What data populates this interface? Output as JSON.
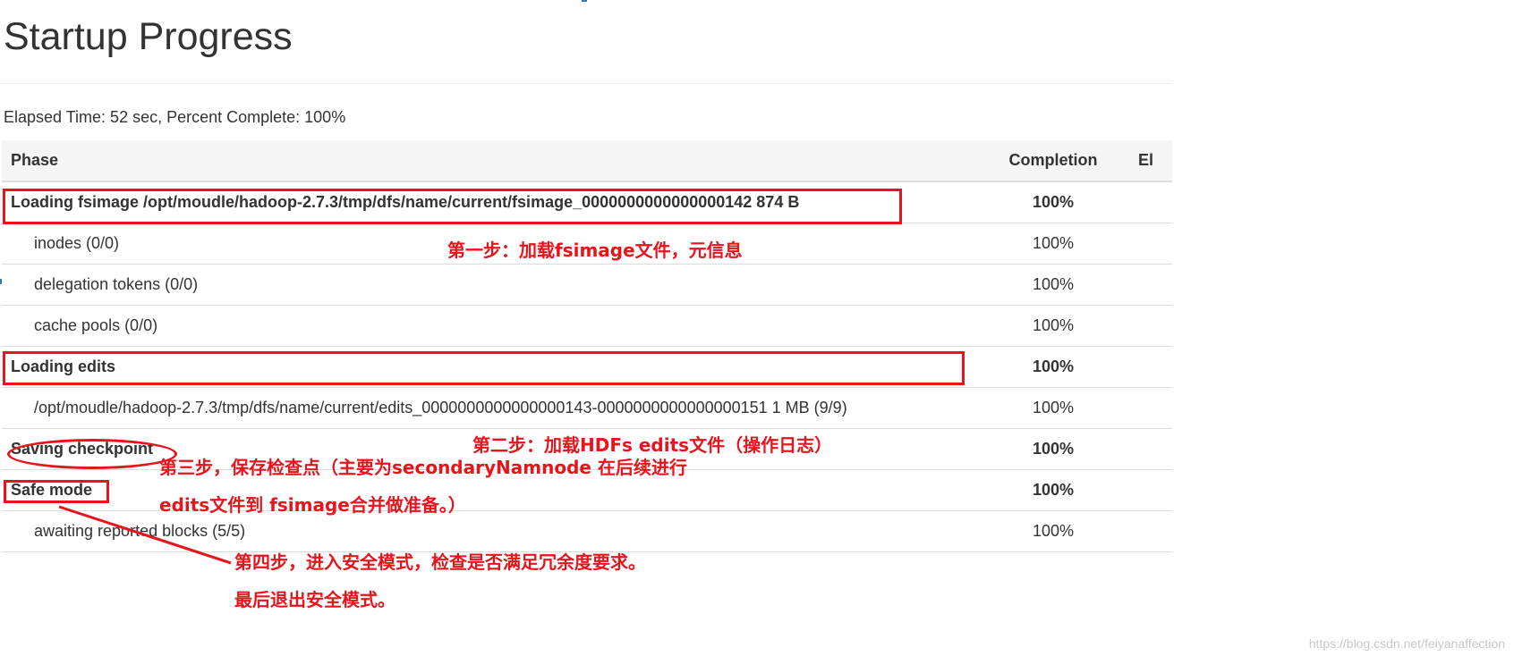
{
  "page": {
    "title": "Startup Progress",
    "elapsed_summary": "Elapsed Time: 52 sec, Percent Complete: 100%"
  },
  "table": {
    "columns": {
      "phase": "Phase",
      "completion": "Completion",
      "elapsed": "El"
    },
    "rows": [
      {
        "kind": "phase",
        "label": "Loading fsimage /opt/moudle/hadoop-2.7.3/tmp/dfs/name/current/fsimage_0000000000000000142 874 B",
        "completion": "100%"
      },
      {
        "kind": "step",
        "label": "inodes (0/0)",
        "completion": "100%"
      },
      {
        "kind": "step",
        "label": "delegation tokens (0/0)",
        "completion": "100%"
      },
      {
        "kind": "step",
        "label": "cache pools (0/0)",
        "completion": "100%"
      },
      {
        "kind": "phase",
        "label": "Loading edits",
        "completion": "100%"
      },
      {
        "kind": "step",
        "label": "/opt/moudle/hadoop-2.7.3/tmp/dfs/name/current/edits_0000000000000000143-0000000000000000151 1 MB (9/9)",
        "completion": "100%"
      },
      {
        "kind": "phase",
        "label": "Saving checkpoint",
        "completion": "100%"
      },
      {
        "kind": "phase",
        "label": "Safe mode",
        "completion": "100%"
      },
      {
        "kind": "step",
        "label": "awaiting reported blocks (5/5)",
        "completion": "100%"
      }
    ]
  },
  "annotations": {
    "step1": "第一步：加载fsimage文件，元信息",
    "step2": "第二步：加载HDFs edits文件（操作日志）",
    "step3_line1": "第三步，保存检查点（主要为secondaryNamnode 在后续进行",
    "step3_line2": "edits文件到 fsimage合并做准备。）",
    "step4_line1": "第四步，进入安全模式，检查是否满足冗余度要求。",
    "step4_line2": "最后退出安全模式。",
    "color": "#e8141c"
  },
  "watermark": "https://blog.csdn.net/feiyanaffection",
  "colors": {
    "header_bg": "#f5f5f5",
    "border": "#dddddd",
    "text": "#333333",
    "annotation_red": "#e8141c"
  }
}
